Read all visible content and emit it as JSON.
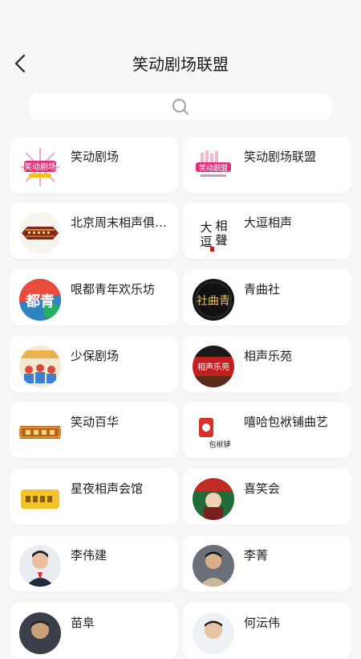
{
  "header": {
    "title": "笑动剧场联盟"
  },
  "icons": {
    "back": "chevron-left-icon",
    "search": "search-icon"
  },
  "items": [
    {
      "label": "笑动剧场",
      "logo_text": "笑动剧场"
    },
    {
      "label": "笑动剧场联盟",
      "logo_text": "笑动剧盟"
    },
    {
      "label": "北京周末相声俱乐部"
    },
    {
      "label": "大逗相声",
      "logo_text": "大逗相聲"
    },
    {
      "label": "哏都青年欢乐坊",
      "logo_text": "都青"
    },
    {
      "label": "青曲社",
      "logo_text": "社曲青"
    },
    {
      "label": "少保剧场"
    },
    {
      "label": "相声乐苑",
      "logo_text": "相声乐苑"
    },
    {
      "label": "笑动百华"
    },
    {
      "label": "嘻哈包袱铺曲艺",
      "logo_text": "包袱铺"
    },
    {
      "label": "星夜相声会馆"
    },
    {
      "label": "喜笑会"
    },
    {
      "label": "李伟建"
    },
    {
      "label": "李菁"
    },
    {
      "label": "苗阜"
    },
    {
      "label": "何沄伟"
    }
  ]
}
